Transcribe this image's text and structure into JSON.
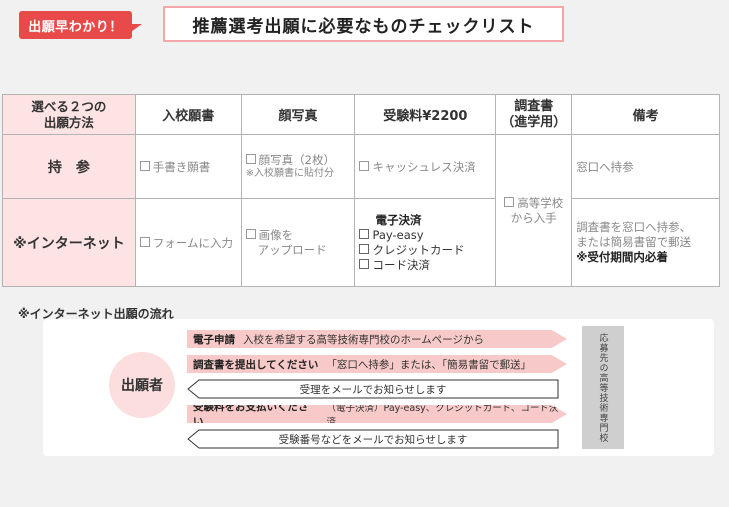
{
  "badge": "出願早わかり！",
  "title": "推薦選考出願に必要なものチェックリスト",
  "table": {
    "corner": [
      "選べる２つの",
      "出願方法"
    ],
    "headers": {
      "application_form": "入校願書",
      "photo": "顔写真",
      "fee": "受験料¥2200",
      "report_1": "調査書",
      "report_2": "（進学用）",
      "notes": "備考"
    },
    "row_in_person": {
      "label": "持　参",
      "application_form": "手書き願書",
      "photo": "顔写真（2枚）",
      "photo_note": "※入校願書に貼付分",
      "fee": "キャッシュレス決済",
      "notes": "窓口へ持参"
    },
    "report_shared": [
      "高等学校",
      "から入手"
    ],
    "row_internet": {
      "label": "※インターネット",
      "application_form": "フォームに入力",
      "photo_1": "画像を",
      "photo_2": "アップロード",
      "fee_title": "電子決済",
      "fee_options": [
        "Pay-easy",
        "クレジットカード",
        "コード決済"
      ],
      "notes_1": "調査書を窓口へ持参、",
      "notes_2": "または簡易書留で郵送",
      "notes_3": "※受付期間内必着"
    }
  },
  "flow": {
    "title": "※インターネット出願の流れ",
    "actor": "出願者",
    "steps": [
      {
        "bold": "電子申請",
        "text": "入校を希望する高等技術専門校のホームページから"
      },
      {
        "bold": "調査書を提出してください",
        "text": "「窓口へ持参」または、「簡易書留で郵送」"
      },
      {
        "bold": "",
        "text": "受理をメールでお知らせします"
      },
      {
        "bold": "受験料をお支払いください",
        "text": "（電子決済）Pay-easy、クレジットカード、コード決済"
      },
      {
        "bold": "",
        "text": "受験番号などをメールでお知らせします"
      }
    ],
    "side_label": "応募先の高等技術専門校"
  }
}
